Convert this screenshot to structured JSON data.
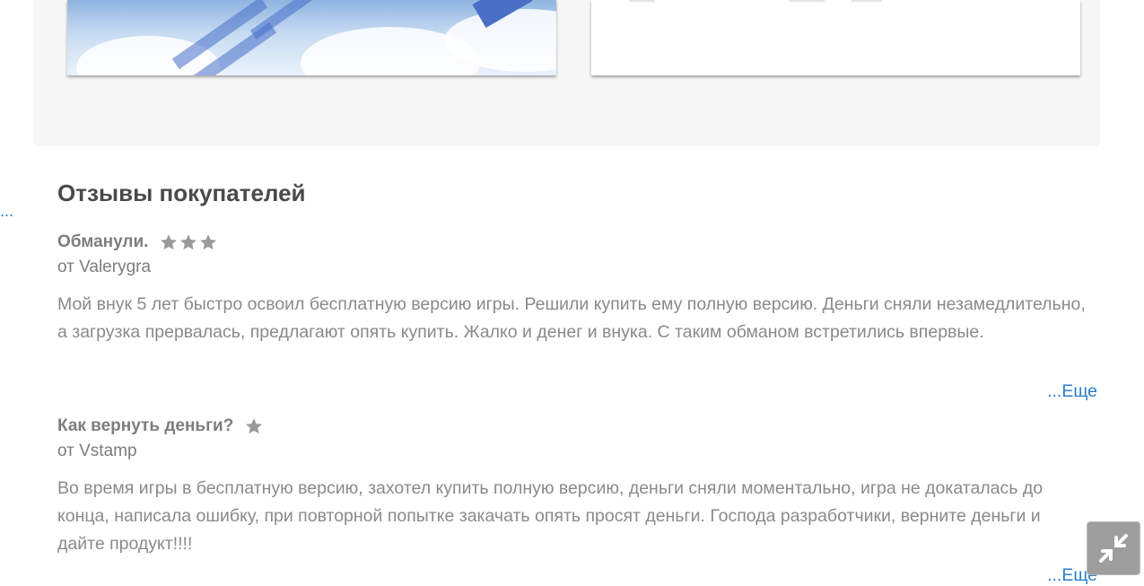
{
  "left_link": "...",
  "reviews_section": {
    "title": "Отзывы покупателей",
    "reviews": [
      {
        "title": "Обманули.",
        "rating": 3,
        "author": "от Valerygra",
        "body": "Мой внук 5 лет быстро освоил бесплатную версию игры. Решили купить ему полную версию. Деньги сняли незамедлительно, а загрузка прервалась, предлагают опять купить. Жалко и денег и внука. С таким обманом встретились впервые.",
        "more": "...Еще"
      },
      {
        "title": "Как вернуть деньги?",
        "rating": 1,
        "author": "от Vstamp",
        "body": "Во время игры в бесплатную версию, захотел купить полную версию, деньги сняли моментально, игра не докаталась до конца, написала ошибку, при повторной попытке закачать опять просят деньги. Господа разработчики, верните деньги и дайте продукт!!!!",
        "more": "...Еще"
      }
    ]
  },
  "colors": {
    "link": "#2a7fc9",
    "star": "#9a9a9a",
    "panel_background": "#f6f6f6"
  },
  "icons": {
    "star": "star-icon",
    "collapse": "collapse-icon"
  }
}
